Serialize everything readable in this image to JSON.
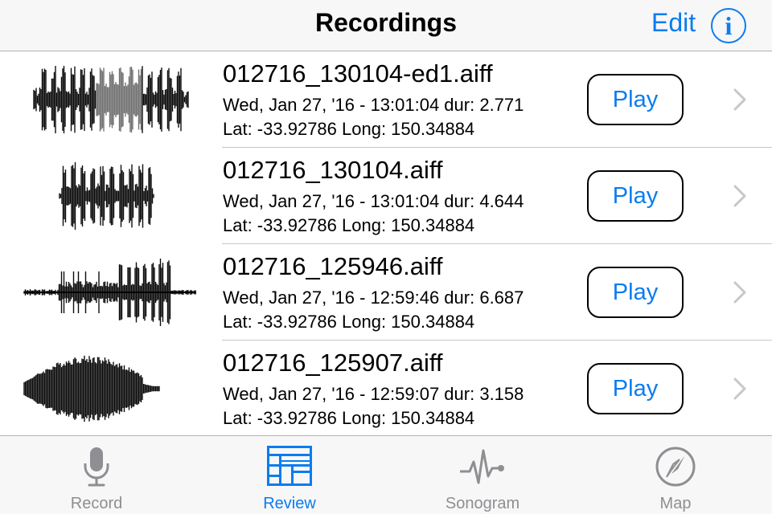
{
  "navbar": {
    "title": "Recordings",
    "edit_label": "Edit",
    "info_glyph": "i"
  },
  "recordings": [
    {
      "filename": "012716_130104-ed1.aiff",
      "datetime_duration": "Wed, Jan 27, '16 - 13:01:04 dur: 2.771",
      "location": "Lat: -33.92786 Long: 150.34884",
      "play_label": "Play",
      "waveform_icon": "waveform-thumbnail"
    },
    {
      "filename": "012716_130104.aiff",
      "datetime_duration": "Wed, Jan 27, '16 - 13:01:04 dur: 4.644",
      "location": "Lat: -33.92786 Long: 150.34884",
      "play_label": "Play",
      "waveform_icon": "waveform-thumbnail"
    },
    {
      "filename": "012716_125946.aiff",
      "datetime_duration": "Wed, Jan 27, '16 - 12:59:46 dur: 6.687",
      "location": "Lat: -33.92786 Long: 150.34884",
      "play_label": "Play",
      "waveform_icon": "waveform-thumbnail"
    },
    {
      "filename": "012716_125907.aiff",
      "datetime_duration": "Wed, Jan 27, '16 - 12:59:07 dur: 3.158",
      "location": "Lat: -33.92786 Long: 150.34884",
      "play_label": "Play",
      "waveform_icon": "waveform-thumbnail"
    }
  ],
  "tabbar": {
    "tabs": [
      {
        "label": "Record",
        "icon": "microphone-icon",
        "active": false
      },
      {
        "label": "Review",
        "icon": "review-list-icon",
        "active": true
      },
      {
        "label": "Sonogram",
        "icon": "sonogram-icon",
        "active": false
      },
      {
        "label": "Map",
        "icon": "compass-icon",
        "active": false
      }
    ]
  },
  "colors": {
    "accent": "#0a7cf0",
    "inactive": "#8e8e93",
    "bar_background": "#f7f7f7",
    "separator": "#c8c7cc"
  }
}
